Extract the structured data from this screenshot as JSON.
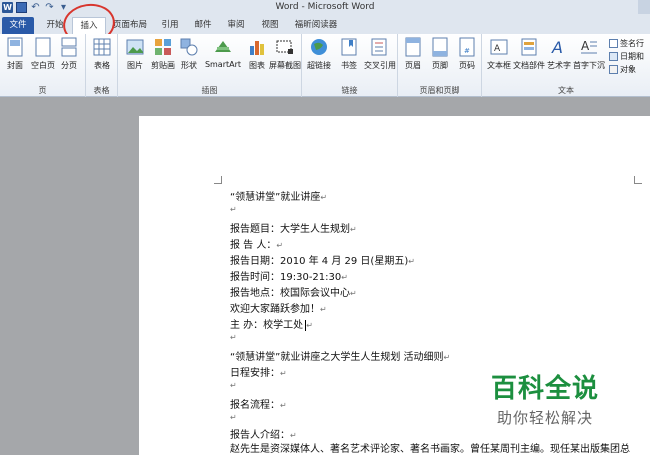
{
  "window": {
    "title": "Word - Microsoft Word",
    "qat": {
      "app_icon": "W",
      "undo": "↶",
      "redo": "↷",
      "more": "▾"
    }
  },
  "tabs": [
    "文件",
    "开始",
    "插入",
    "页面布局",
    "引用",
    "邮件",
    "审阅",
    "视图",
    "福昕阅读器"
  ],
  "ribbon": {
    "groups": {
      "pages": "页",
      "tables": "表格",
      "illustrations": "插图",
      "links": "链接",
      "header_footer": "页眉和页脚",
      "text": "文本"
    },
    "buttons": {
      "cover": "封面",
      "blank": "空白页",
      "break": "分页",
      "table": "表格",
      "picture": "图片",
      "clipart": "剪贴画",
      "shapes": "形状",
      "smartart": "SmartArt",
      "chart": "图表",
      "screenshot": "屏幕截图",
      "hyperlink": "超链接",
      "bookmark": "书签",
      "crossref": "交叉引用",
      "header": "页眉",
      "footer": "页脚",
      "pagenum": "页码",
      "textbox": "文本框",
      "quickparts": "文档部件",
      "wordart": "艺术字",
      "dropcap": "首字下沉",
      "signature": "签名行",
      "datetime": "日期和",
      "object": "对象"
    }
  },
  "document": {
    "lines": [
      "“领慧讲堂”就业讲座",
      "",
      "报告题目：大学生人生规划",
      "报  告  人：",
      "报告日期：2010 年 4 月 29 日(星期五)",
      "报告时间：19:30-21:30",
      "报告地点：校国际会议中心",
      "欢迎大家踊跃参加！",
      "主  办：校学工处",
      "",
      "“领慧讲堂”就业讲座之大学生人生规划  活动细则",
      "日程安排：",
      "",
      "报名流程：",
      "",
      "报告人介绍：",
      "赵先生是资深媒体人、著名艺术评论家、著名书画家。曾任某周刊主编。现任某出版集团总"
    ],
    "paragraph_mark": "↵"
  },
  "watermark": {
    "title": "百科全说",
    "subtitle": "助你轻松解决"
  },
  "colors": {
    "file_tab": "#2a5aa8",
    "highlight_circle": "#d8362e",
    "watermark_green": "#1c8f3f"
  }
}
